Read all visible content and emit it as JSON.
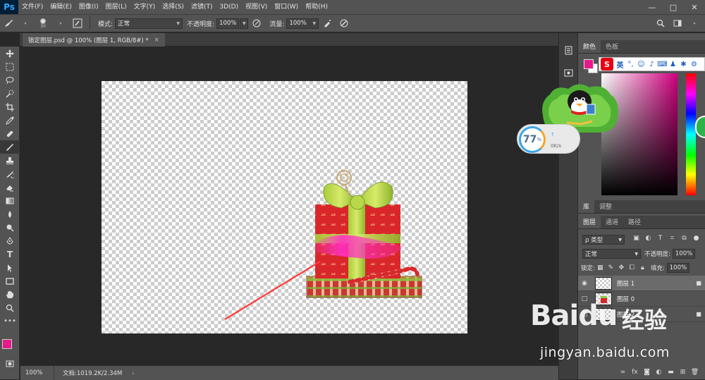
{
  "app": {
    "logo": "Ps",
    "menu": [
      "文件(F)",
      "编辑(E)",
      "图像(I)",
      "图层(L)",
      "文字(Y)",
      "选择(S)",
      "滤镜(T)",
      "3D(D)",
      "视图(V)",
      "窗口(W)",
      "帮助(H)"
    ],
    "window_controls": {
      "minimize": "—",
      "maximize": "□",
      "close": "✕"
    }
  },
  "options": {
    "brush_size": "30",
    "mode_label": "模式:",
    "mode_value": "正常",
    "opacity_label": "不透明度:",
    "opacity_value": "100%",
    "flow_label": "流量:",
    "flow_value": "100%"
  },
  "document": {
    "tab_title": "锁定图层.psd @ 100% (图层 1, RGB/8#) *",
    "close_glyph": "×"
  },
  "status": {
    "zoom": "100%",
    "doc_info": "文档:1019.2K/2.34M",
    "arrow": "›"
  },
  "color_panel": {
    "tabs": [
      "颜色",
      "色板"
    ],
    "foreground": "#e8198b",
    "background": "#ffffff"
  },
  "library_panel": {
    "tabs": [
      "库",
      "调整"
    ]
  },
  "layers_panel": {
    "tabs": [
      "图层",
      "通道",
      "路径"
    ],
    "filter_label": "ρ 类型",
    "blend_mode": "正常",
    "opacity_label": "不透明度:",
    "opacity_value": "100%",
    "lock_label": "锁定:",
    "fill_label": "填充:",
    "fill_value": "100%",
    "layers": [
      {
        "name": "图层 1",
        "visible": true,
        "locked": true,
        "selected": true
      },
      {
        "name": "图层 0",
        "visible": false,
        "locked": false,
        "selected": false
      },
      {
        "name": "图层 2",
        "visible": false,
        "locked": true,
        "selected": false
      }
    ],
    "footer_icons": [
      "link-icon",
      "fx-icon",
      "mask-icon",
      "adjustment-icon",
      "folder-icon",
      "new-layer-icon",
      "trash-icon"
    ]
  },
  "overlays": {
    "ime_label": "英",
    "speed_percent": "77",
    "speed_unit": "%",
    "speed_rate": "0K/s",
    "watermark_brand": "Baidu",
    "watermark_cn": "经验",
    "watermark_url": "jingyan.baidu.com"
  },
  "colors": {
    "accent": "#31a8ff",
    "panel": "#535353",
    "pasteboard": "#282828",
    "magenta": "#e8198b"
  }
}
